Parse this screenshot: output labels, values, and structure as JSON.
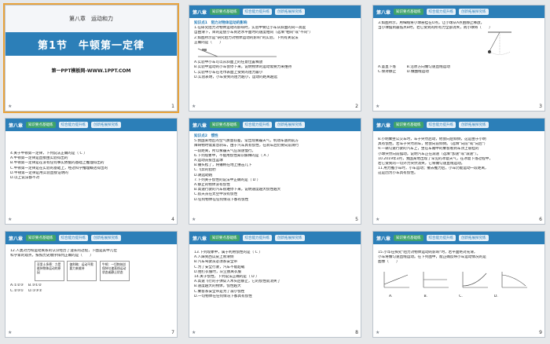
{
  "header": {
    "chapter": "第八章",
    "tab1": "知识要点基础练",
    "tab2": "综合能力提升练",
    "tab3": "创新拓展探究练"
  },
  "slide1": {
    "chapter_title": "第八章　运动和力",
    "section_title": "第1节　牛顿第一定律",
    "footer": "第一PPT模板网-WWW.1PPT.COM"
  },
  "slide2": {
    "tag": "知识点1　阻力对物体运动的影响",
    "lines": [
      "1.在研究阻力对物体运动的影响时，实验中要让小车从斜面的同一高度",
      "自由滑下，目的是使小车到达水平面时的速度相同（选填\"相同\"或\"不同\"）",
      "2.如图所示是\"研究阻力对物体运动的影响\"的实验，下列有关说法",
      "正确的是（　　）",
      "A.实验中小车可以从斜面上的任意位置释放",
      "B.实验中运动的小车会停下来，说明物体的运动需要力来维持",
      "C.实验中小车在毛巾表面上受到的阻力最小",
      "D.实验表明，小车受到的阻力越小，运动的距离越远"
    ]
  },
  "slide3": {
    "lines": [
      "3.如图所示，用细线将小球悬挂在O点，让小球从A点由静止释放，",
      "当小球摆到最低点B时，若它受到的所有力全部消失，则小球将（　　）",
      "A.竖直下落　　　B.沿原方向做匀速直线运动",
      "C.保持静止　　　D.做曲线运动"
    ]
  },
  "slide4": {
    "lines": [
      "4.关于牛顿第一定律，下列说法正确的是（ C ）",
      "A.牛顿第一定律是直接由实验得出的",
      "B.牛顿第一定律是在没有任何事实依据的基础上推理得出的",
      "C.牛顿第一定律是在实验的基础上，经过科学推理概括得出的",
      "D.牛顿第一定律是用实验直接证明的",
      "D.以上说法都不对"
    ]
  },
  "slide5": {
    "tag": "知识点2　惯性",
    "lines": [
      "5.我国某地区的空气质量较差，常出现雾霾天气，机动车遇到前方",
      "障碍物时需紧急刹车，由于汽车具有惯性，在刹车后仍要向前滑行",
      "一段距离，所以雾霾天气应减速慢行。",
      "6.下列现象中，不能用惯性知识解释的是（ A ）",
      "A.运动员投出篮球",
      "B.锤头松了，将锤柄在地上撞击几下",
      "C.飞奔的猎豹",
      "D.跳远助跑",
      "7.下列关于惯性的说法中正确的是（ D ）",
      "A.静止的物体没有惯性",
      "B.高速行驶的汽车很难停下来，说明速度越大惯性越大",
      "C.航天员在太空中没有惯性",
      "D.任何物体在任何情况下都有惯性"
    ]
  },
  "slide6": {
    "lines": [
      "8.小明乘坐公交车时，车子突然启动，他会向后倾倒，这是由于小明",
      "具有惯性。若车子突然刹车，他会向前倾倒。（选填\"向前\"或\"向后\"）",
      "9.一辆匀速行驶的汽车上，坐在车厢中的乘客看到车顶上悬挂的",
      "小球突然向前摆动，说明汽车正在减速（选填\"加速\"或\"减速\"）。",
      "10.2019年3月，我国某地出现了罕见的冰雹天气，在冰雹下落过程中，",
      "若它受到的一切外力突然消失，它将做匀速直线运动。",
      "11.用力推小车时，小车运动；撤去推力后，小车仍能运动一段距离，",
      "这是因为小车具有惯性。"
    ]
  },
  "slide7": {
    "lines": [
      "12.人类对力和运动关系的认识经历了漫长的过程，下图是其中几位",
      "科学家的观点，按照历史顺序排列正确的是（　　）"
    ],
    "figs": [
      "亚里士多德：力是维持物体运动的原因",
      "伽利略：运动不需要力来维持",
      "牛顿：一切物体总保持匀速直线运动状态或静止状态"
    ],
    "options": [
      "A.①②③",
      "B.③①②",
      "C.②③①",
      "D.①③②"
    ]
  },
  "slide8": {
    "lines": [
      "13.下列现象中，属于利用惯性的是（ C ）",
      "A.人踩到西瓜皮上易滑倒",
      "B.汽车驾驶员必须系安全带",
      "C.为了安全行驶，汽车不能超载",
      "D.拍打衣服时，灰尘脱离衣服",
      "14.关于惯性，下列说法正确的是（ D ）",
      "A.高速飞行的子弹穿入木头后静止，它的惯性就消失了",
      "B.速度越大的物体，惯性越大",
      "C.乘客系安全带是为了减小惯性",
      "D.一切物体在任何情况下都具有惯性"
    ]
  },
  "slide9": {
    "lines": [
      "15.小华在探究\"阻力对物体运动的影响\"时，若平面绝对光滑，",
      "小车将做匀速直线运动。在下列图中，能正确反映小车运动情况的是",
      "图像（　　）"
    ],
    "options": [
      "A.",
      "B.",
      "C.",
      "D."
    ]
  },
  "page_numbers": [
    "1",
    "2",
    "3",
    "4",
    "5",
    "6",
    "7",
    "8",
    "9"
  ]
}
